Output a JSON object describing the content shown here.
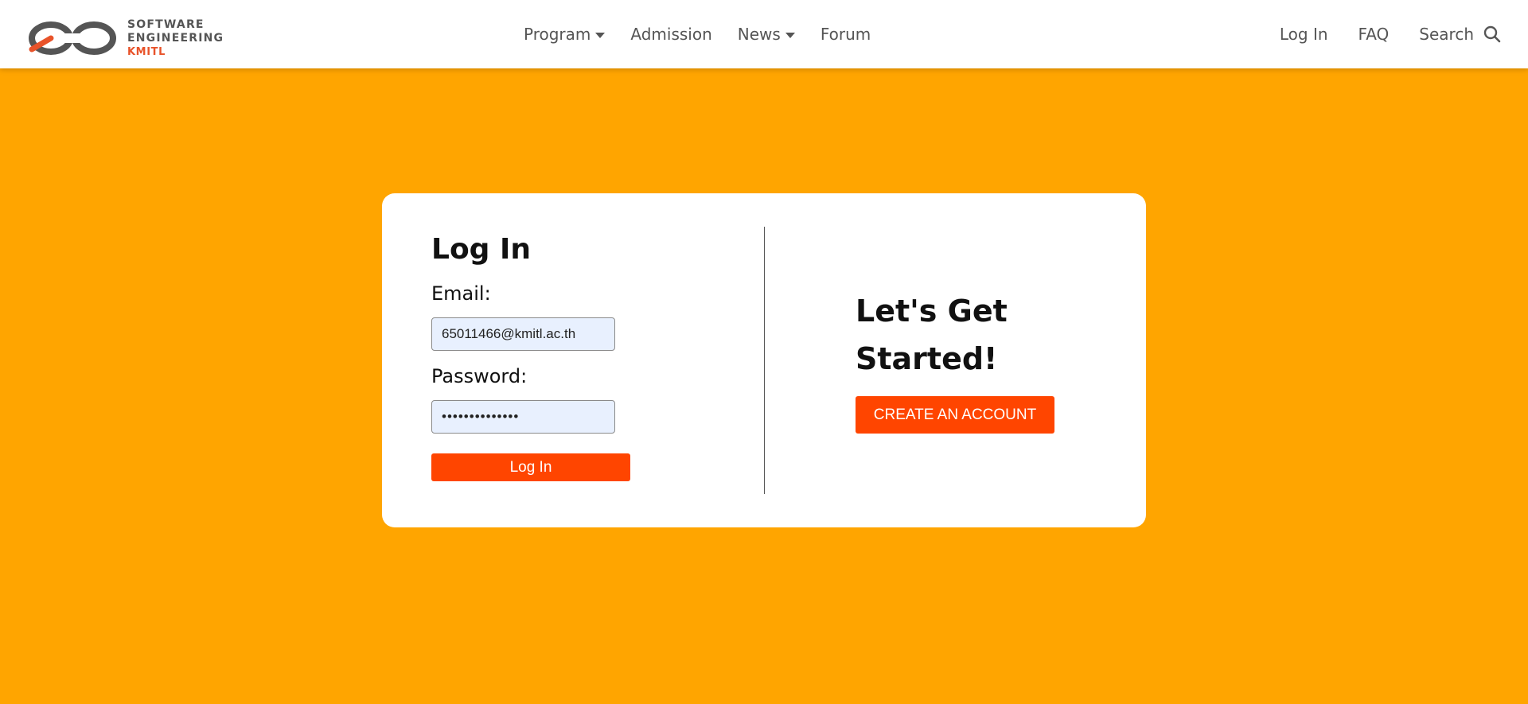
{
  "brand": {
    "line1": "SOFTWARE",
    "line2": "ENGINEERING",
    "line3": "KMITL",
    "logo_icon": "infinity-loop-logo-icon",
    "colors": {
      "gray": "#555555",
      "accent": "#E8532A"
    }
  },
  "nav": {
    "center": [
      {
        "label": "Program",
        "has_dropdown": true
      },
      {
        "label": "Admission",
        "has_dropdown": false
      },
      {
        "label": "News",
        "has_dropdown": true
      },
      {
        "label": "Forum",
        "has_dropdown": false
      }
    ],
    "right": {
      "login": "Log In",
      "faq": "FAQ",
      "search": "Search",
      "search_icon": "search-icon"
    }
  },
  "login": {
    "title": "Log In",
    "email_label": "Email:",
    "email_value": "65011466@kmitl.ac.th",
    "password_label": "Password:",
    "password_value": "••••••••••••••",
    "submit_label": "Log In"
  },
  "signup": {
    "title_line1": "Let's Get",
    "title_line2": "Started!",
    "button_label": "CREATE AN ACCOUNT"
  },
  "colors": {
    "page_background": "#FFA500",
    "button": "#FF4500",
    "input_background": "#E8F0FE"
  }
}
